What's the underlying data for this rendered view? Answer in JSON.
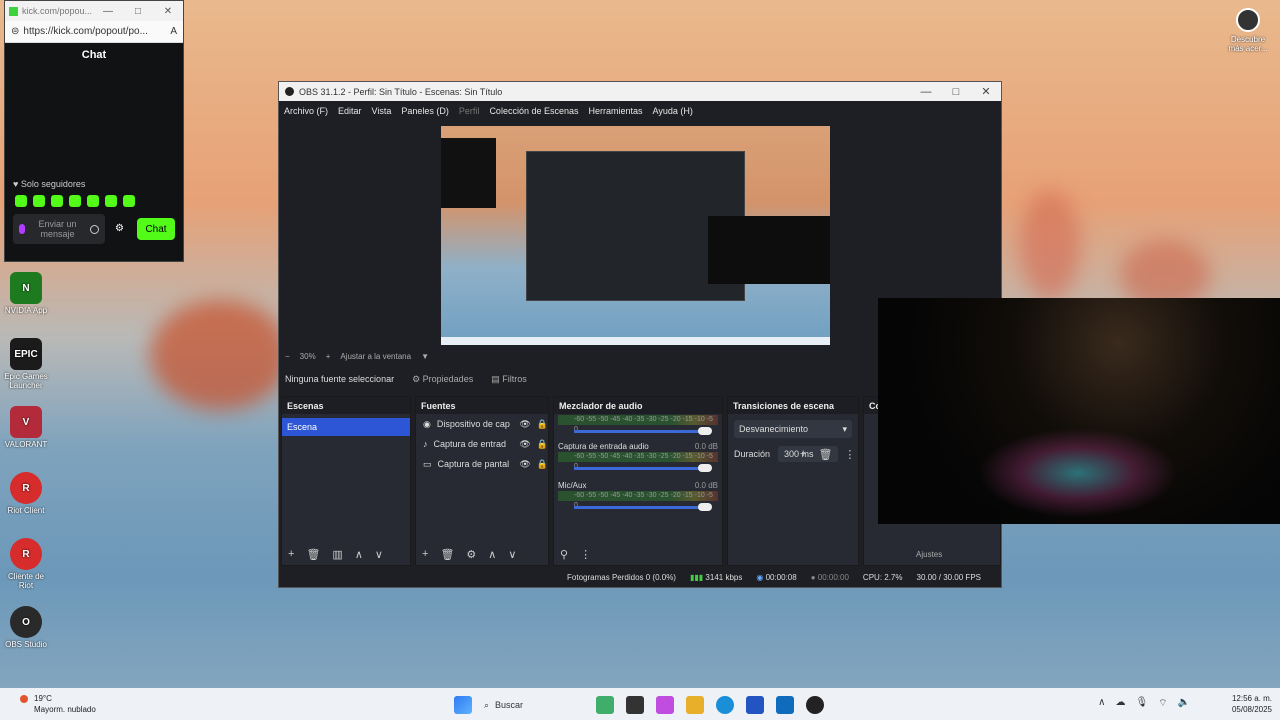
{
  "chat_window": {
    "title": "kick.com/popou...",
    "url": "https://kick.com/popout/po...",
    "header": "Chat",
    "followers_only": "Solo seguidores",
    "input_placeholder": "Enviar un mensaje",
    "send_label": "Chat"
  },
  "desktop": {
    "icons": [
      {
        "label": "NVIDIA App",
        "color": "#1e7a1e"
      },
      {
        "label": "Epic Games Launcher",
        "color": "#1b1b1b"
      },
      {
        "label": "VALORANT",
        "color": "#b32b3a"
      },
      {
        "label": "Riot Client",
        "color": "#d62c2c"
      },
      {
        "label": "Cliente de Riot",
        "color": "#d62c2c"
      },
      {
        "label": "OBS Studio",
        "color": "#2a2a2a"
      }
    ],
    "top_right": "Descubre más acer..."
  },
  "obs": {
    "title": "OBS 31.1.2 - Perfil: Sin Título - Escenas: Sin Título",
    "menu": [
      "Archivo (F)",
      "Editar",
      "Vista",
      "Paneles (D)",
      "Perfil",
      "Colección de Escenas",
      "Herramientas",
      "Ayuda (H)"
    ],
    "zoom": "30%",
    "fit": "Ajustar a la ventana",
    "no_source": "Ninguna fuente seleccionar",
    "properties": "Propiedades",
    "filters": "Filtros",
    "scenes_header": "Escenas",
    "scene_item": "Escena",
    "sources_header": "Fuentes",
    "sources": [
      "Dispositivo de cap",
      "Captura de entrad",
      "Captura de pantal"
    ],
    "mixer_header": "Mezclador de audio",
    "mixer": [
      {
        "name": "",
        "db": ""
      },
      {
        "name": "Captura de entrada audio",
        "db": "0.0 dB"
      },
      {
        "name": "Mic/Aux",
        "db": "0.0 dB"
      }
    ],
    "meter_scale": "-60 -55 -50 -45 -40 -35 -30 -25 -20 -15 -10 -5 0",
    "transitions_header": "Transiciones de escena",
    "transition": "Desvanecimiento",
    "duration_label": "Duración",
    "duration_value": "300 ms",
    "controls_header": "Co",
    "controls_settings": "Ajustes",
    "status": {
      "dropped": "Fotogramas Perdidos 0 (0.0%)",
      "bitrate": "3141 kbps",
      "live_time": "00:00:08",
      "rec_time": "00:00:00",
      "cpu": "CPU: 2.7%",
      "fps": "30.00 / 30.00 FPS"
    }
  },
  "taskbar": {
    "temp": "19°C",
    "weather": "Mayorm. nublado",
    "search": "Buscar",
    "time": "12:56 a. m.",
    "date": "05/08/2025"
  }
}
